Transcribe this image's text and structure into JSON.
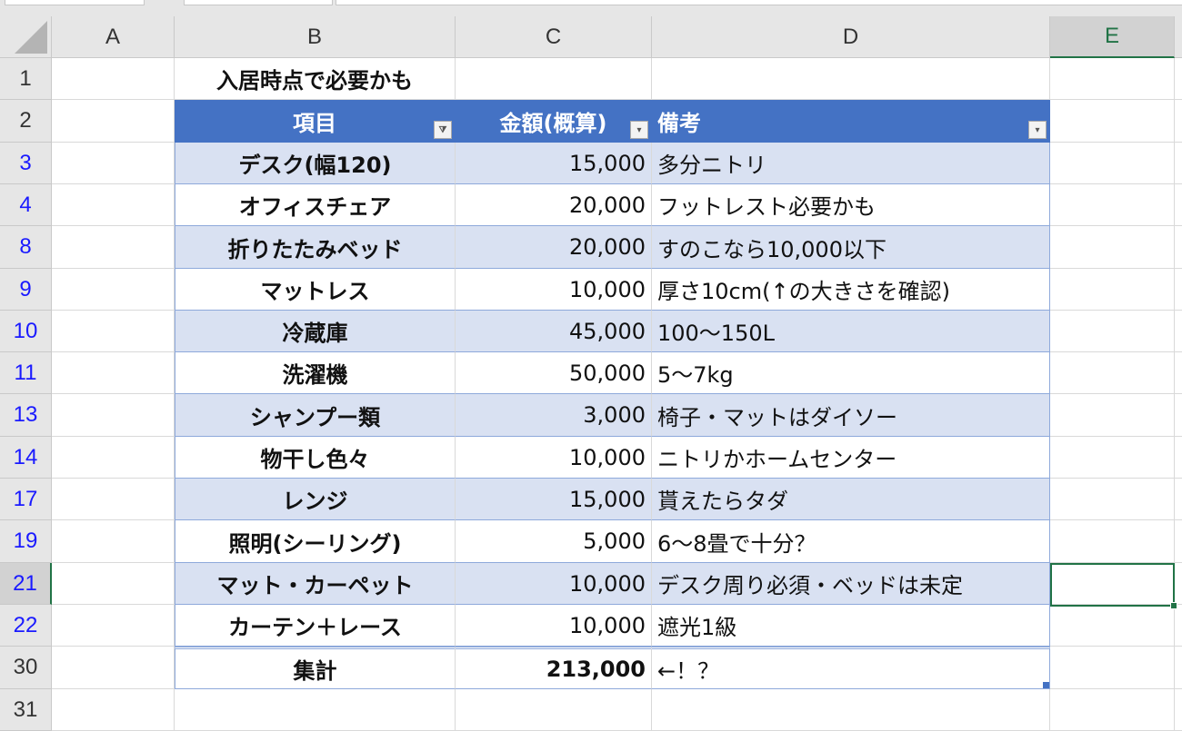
{
  "columns": [
    "A",
    "B",
    "C",
    "D",
    "E"
  ],
  "selected_column": "E",
  "selected_row": "21",
  "title_cell": "入居時点で必要かも",
  "table_headers": [
    "項目",
    "金額(概算)",
    "備考"
  ],
  "rows": [
    {
      "row": "3",
      "item": "デスク(幅120)",
      "amount": "15,000",
      "note": "多分ニトリ"
    },
    {
      "row": "4",
      "item": "オフィスチェア",
      "amount": "20,000",
      "note": "フットレスト必要かも"
    },
    {
      "row": "8",
      "item": "折りたたみベッド",
      "amount": "20,000",
      "note": "すのこなら10,000以下"
    },
    {
      "row": "9",
      "item": "マットレス",
      "amount": "10,000",
      "note": "厚さ10cm(↑の大きさを確認)"
    },
    {
      "row": "10",
      "item": "冷蔵庫",
      "amount": "45,000",
      "note": "100～150L"
    },
    {
      "row": "11",
      "item": "洗濯機",
      "amount": "50,000",
      "note": "5～7kg"
    },
    {
      "row": "13",
      "item": "シャンプー類",
      "amount": "3,000",
      "note": "椅子・マットはダイソー"
    },
    {
      "row": "14",
      "item": "物干し色々",
      "amount": "10,000",
      "note": "ニトリかホームセンター"
    },
    {
      "row": "17",
      "item": "レンジ",
      "amount": "15,000",
      "note": "貰えたらタダ"
    },
    {
      "row": "19",
      "item": "照明(シーリング)",
      "amount": "5,000",
      "note": "6～8畳で十分？"
    },
    {
      "row": "21",
      "item": "マット・カーペット",
      "amount": "10,000",
      "note": "デスク周り必須・ベッドは未定"
    },
    {
      "row": "22",
      "item": "カーテン＋レース",
      "amount": "10,000",
      "note": "遮光1級"
    }
  ],
  "total": {
    "row": "30",
    "item": "集計",
    "amount": "213,000",
    "note": "←！？"
  },
  "extra_rows": [
    "1",
    "2",
    "31"
  ],
  "colors": {
    "header": "#4472c4",
    "band": "#d9e1f2",
    "selection": "#217346"
  }
}
